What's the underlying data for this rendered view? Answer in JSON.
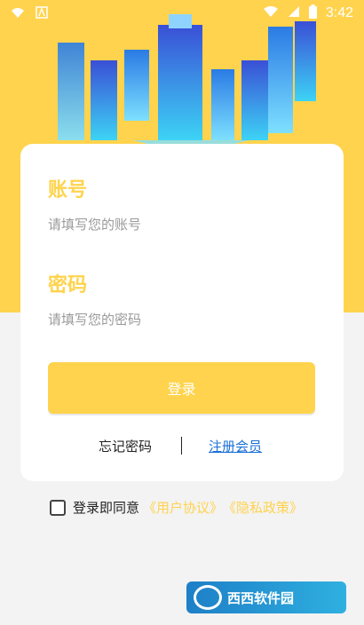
{
  "status_bar": {
    "time": "3:42",
    "icons": [
      "wifi-icon",
      "notification-a-icon",
      "wifi-signal-icon",
      "signal-icon",
      "battery-icon"
    ]
  },
  "login_form": {
    "account_label": "账号",
    "account_placeholder": "请填写您的账号",
    "account_value": "",
    "password_label": "密码",
    "password_placeholder": "请填写您的密码",
    "password_value": "",
    "login_button": "登录",
    "forgot_password": "忘记密码",
    "register": "注册会员"
  },
  "agreement": {
    "checked": false,
    "prefix": "登录即同意",
    "user_agreement": "《用户协议》",
    "privacy_policy": "《隐私政策》"
  },
  "watermark": {
    "text": "西西软件园"
  },
  "colors": {
    "accent": "#ffd34d",
    "link": "#1a6fd6",
    "background": "#f3f3f3"
  }
}
